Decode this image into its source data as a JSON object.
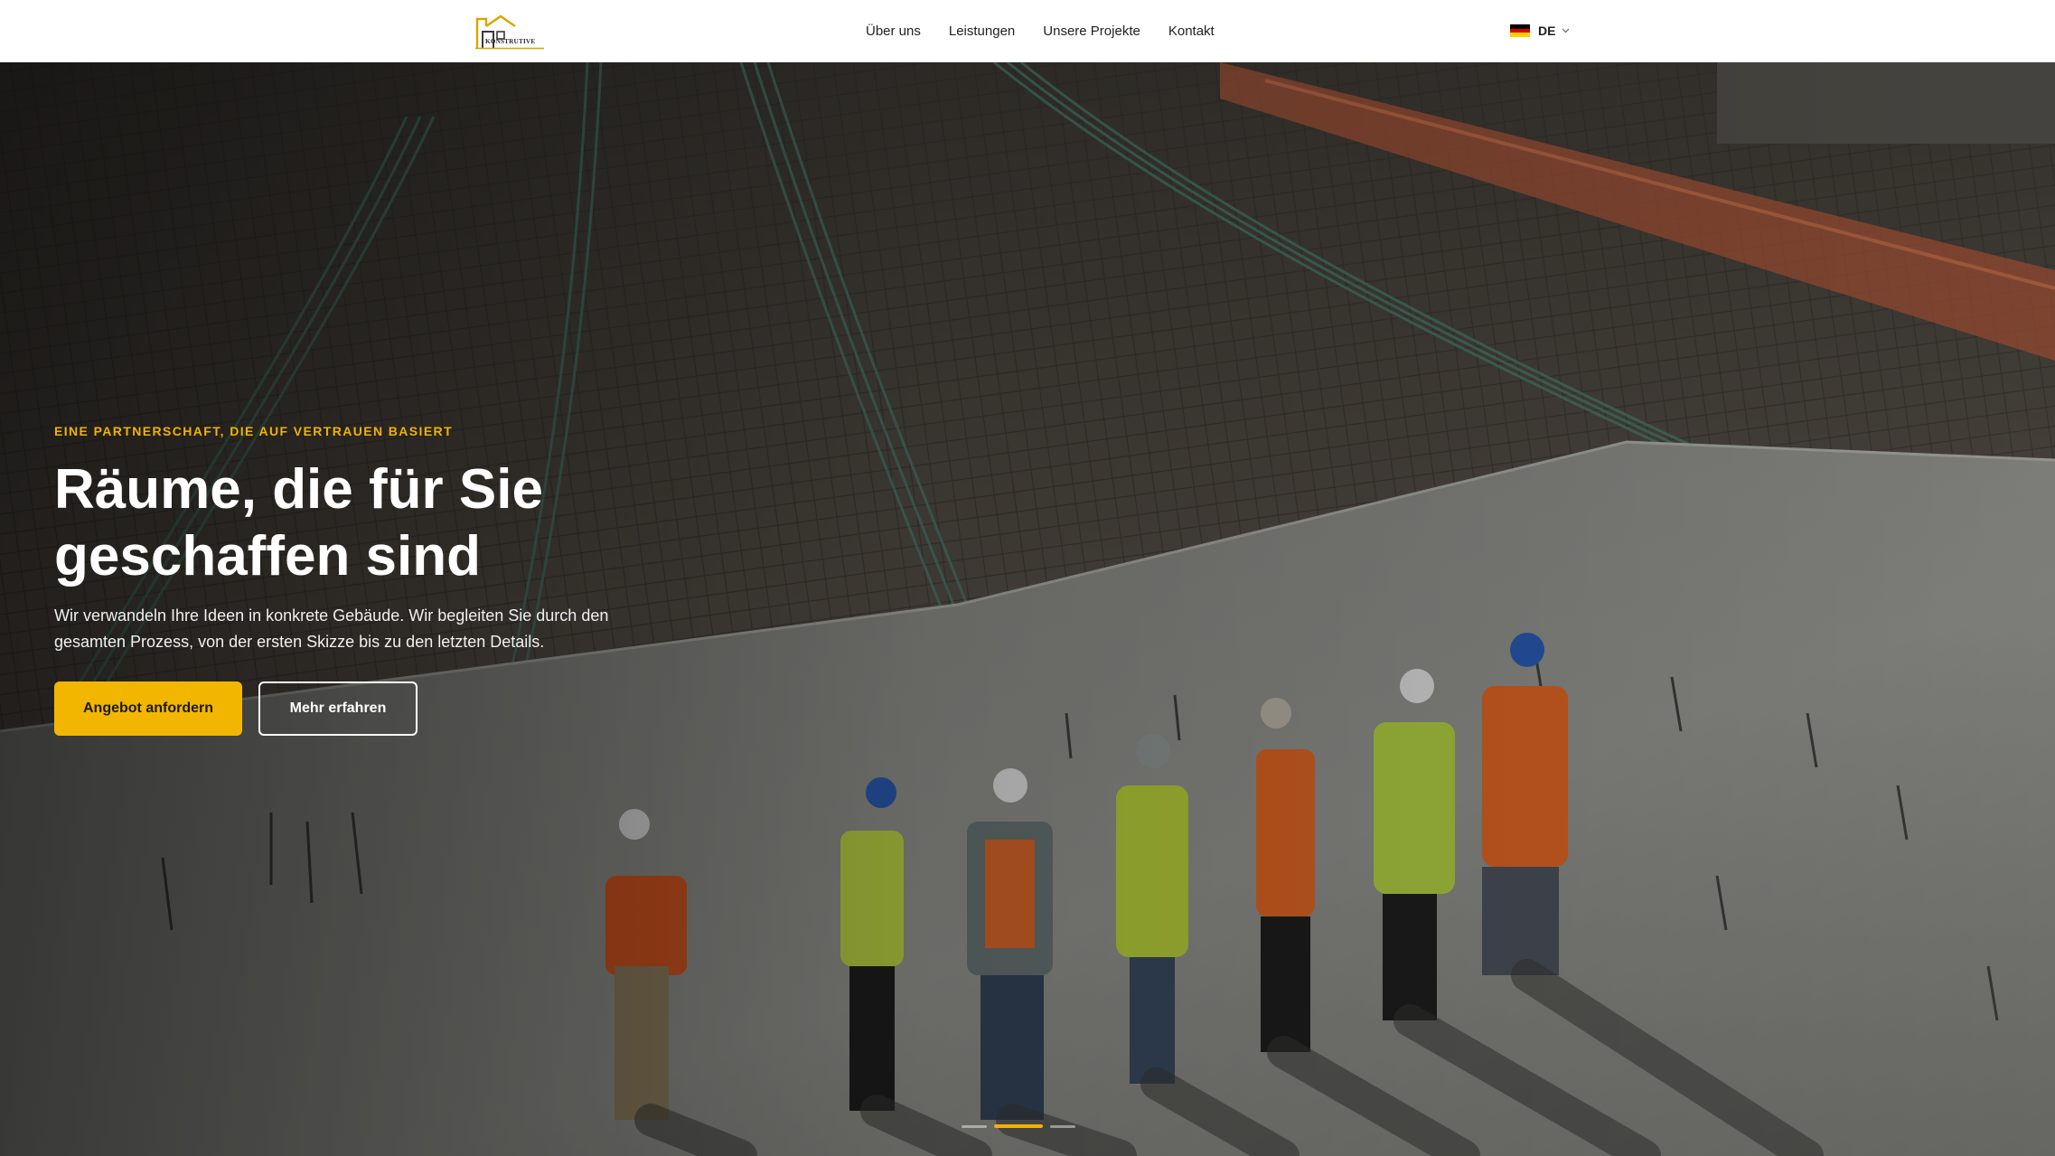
{
  "header": {
    "logo_text": "KONSTRUTIVE",
    "nav": [
      {
        "label": "Über uns"
      },
      {
        "label": "Leistungen"
      },
      {
        "label": "Unsere Projekte"
      },
      {
        "label": "Kontakt"
      }
    ],
    "language": {
      "code": "DE",
      "flag_icon": "germany-flag-icon",
      "flag_colors": [
        "#000000",
        "#dd0000",
        "#ffce00"
      ]
    }
  },
  "hero": {
    "eyebrow": "EINE PARTNERSCHAFT, DIE AUF VERTRAUEN BASIERT",
    "title_line_1": "Räume, die für Sie",
    "title_line_2": "geschaffen sind",
    "description": "Wir verwandeln Ihre Ideen in konkrete Gebäude. Wir begleiten Sie durch den gesamten Prozess, von der ersten Skizze bis zu den letzten Details.",
    "primary_button": "Angebot anfordern",
    "secondary_button": "Mehr erfahren",
    "slides": {
      "count": 3,
      "active_index": 1
    }
  },
  "colors": {
    "accent": "#f3b600",
    "text_dark": "#222222",
    "hero_text": "#ffffff"
  }
}
